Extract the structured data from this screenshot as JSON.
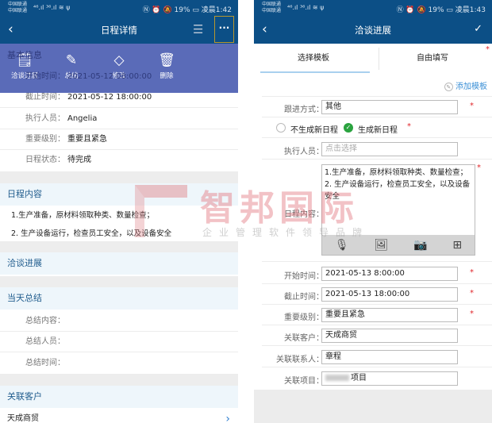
{
  "status_left": {
    "carrier1": "中国联通",
    "carrier2": "中国联通",
    "signal": "⁴⁶.ıl ³⁶.ıl ≋ ψ",
    "right": "Ⓝ ⏰ 🔕 19% ▭ 凌晨1:42"
  },
  "status_right": {
    "carrier1": "中国联通",
    "carrier2": "中国联通",
    "signal": "⁴⁶.ıl ³⁶.ıl ≋ ψ",
    "right": "Ⓝ ⏰ 🔕 19% ▭ 凌晨1:43"
  },
  "left": {
    "title": "日程详情",
    "popup": [
      {
        "label": "洽谈进展",
        "icon": "notes-icon"
      },
      {
        "label": "总结",
        "icon": "edit-doc-icon"
      },
      {
        "label": "修改",
        "icon": "eraser-icon"
      },
      {
        "label": "删除",
        "icon": "trash-icon"
      }
    ],
    "basic_header": "基本信息",
    "fields": [
      {
        "label": "开始时间：",
        "value": "2021-05-12 08:00:00"
      },
      {
        "label": "截止时间：",
        "value": "2021-05-12 18:00:00"
      },
      {
        "label": "执行人员：",
        "value": "Angelia"
      },
      {
        "label": "重要级别：",
        "value": "重要且紧急"
      },
      {
        "label": "日程状态：",
        "value": "待完成"
      }
    ],
    "content_header": "日程内容",
    "content_lines": [
      "1.生产准备，原材料领取种类、数量检查；",
      "2. 生产设备运行，检查员工安全，以及设备安全"
    ],
    "progress_header": "洽谈进展",
    "summary_header": "当天总结",
    "summary_fields": [
      {
        "label": "总结内容："
      },
      {
        "label": "总结人员："
      },
      {
        "label": "总结时间："
      }
    ],
    "customer_header": "关联客户",
    "customer": "天成商贸"
  },
  "watermark": {
    "brand": "智邦国际",
    "slogan": "企业管理软件领导品牌"
  },
  "right": {
    "title": "洽谈进展",
    "tabs": [
      "选择模板",
      "自由填写"
    ],
    "add_template": "添加模板",
    "followup": {
      "label": "跟进方式：",
      "value": "其他"
    },
    "radio": {
      "no": "不生成新日程",
      "yes": "生成新日程"
    },
    "executor": {
      "label": "执行人员：",
      "placeholder": "点击选择"
    },
    "content": {
      "label": "日程内容：",
      "lines": [
        "1.生产准备，原材料领取种类、数量检查；",
        "2. 生产设备运行，检查员工安全，以及设备安全"
      ]
    },
    "fields": [
      {
        "label": "开始时间：",
        "value": "2021-05-13 8:00:00",
        "required": true
      },
      {
        "label": "截止时间：",
        "value": "2021-05-13 18:00:00",
        "required": true
      },
      {
        "label": "重要级别：",
        "value": "重要且紧急",
        "required": true
      },
      {
        "label": "关联客户：",
        "value": "天成商贸"
      },
      {
        "label": "关联联系人：",
        "value": "章程"
      },
      {
        "label": "关联项目：",
        "value": "项目"
      }
    ],
    "star": "*"
  }
}
